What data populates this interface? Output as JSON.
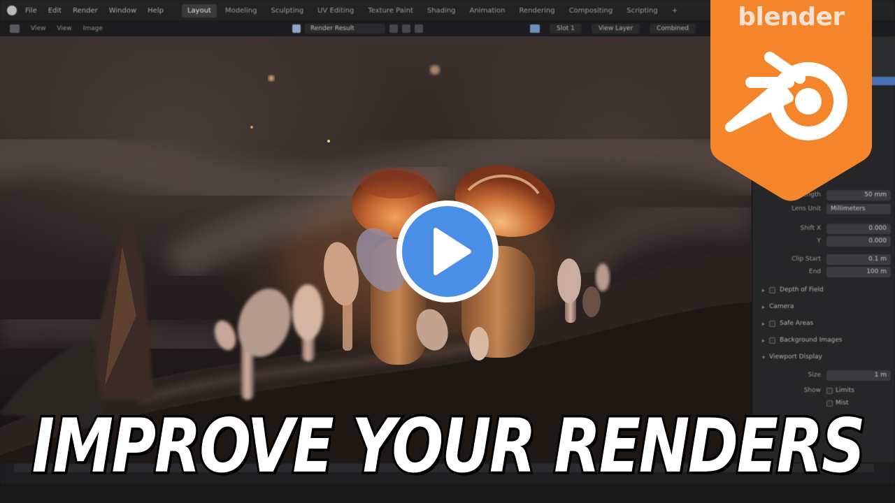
{
  "menubar": {
    "menus": [
      "File",
      "Edit",
      "Render",
      "Window",
      "Help"
    ],
    "workspaces": [
      "Layout",
      "Modeling",
      "Sculpting",
      "UV Editing",
      "Texture Paint",
      "Shading",
      "Animation",
      "Rendering",
      "Compositing",
      "Scripting",
      "+"
    ],
    "active_workspace": "Layout"
  },
  "image_editor_header": {
    "menus": [
      "View",
      "View",
      "Image"
    ],
    "image_name": "Render Result",
    "slot": "Slot 1",
    "view_layer": "View Layer",
    "combined": "Combined"
  },
  "properties_panel": {
    "focal_length_label": "Length",
    "focal_length_value": "50 mm",
    "lens_unit_label": "Lens Unit",
    "lens_unit_value": "Millimeters",
    "shift_x_label": "Shift X",
    "shift_x_value": "0.000",
    "shift_y_label": "Y",
    "shift_y_value": "0.000",
    "clip_start_label": "Clip Start",
    "clip_start_value": "0.1 m",
    "clip_end_label": "End",
    "clip_end_value": "100 m",
    "sections": [
      "Depth of Field",
      "Camera",
      "Safe Areas",
      "Background Images",
      "Viewport Display"
    ],
    "size_label": "Size",
    "size_value": "1 m",
    "show_label": "Show",
    "show_options": [
      "Limits",
      "Mist"
    ]
  },
  "logo": {
    "wordmark": "blender",
    "accent": "#f5852b"
  },
  "play_button": {
    "icon": "play-icon",
    "color": "#4b8ee6"
  },
  "caption": {
    "text": "IMPROVE YOUR RENDERS"
  }
}
